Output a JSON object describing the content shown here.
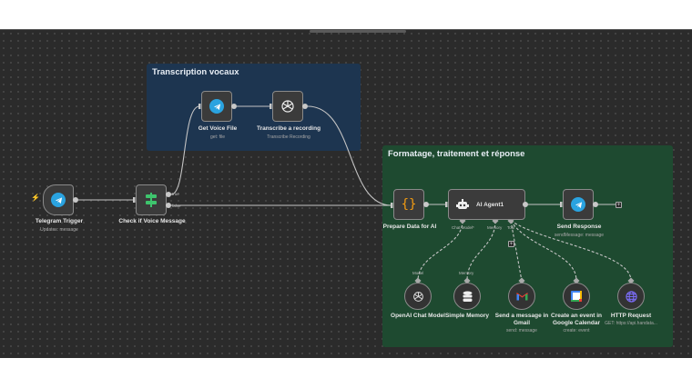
{
  "groups": [
    {
      "title": "Transcription vocaux",
      "color": "#1d3550"
    },
    {
      "title": "Formatage, traitement et réponse",
      "color": "#1e4a30"
    }
  ],
  "nodes": {
    "telegram_trigger": {
      "label": "Telegram Trigger",
      "sub": "Updates: message",
      "icon": "telegram-icon"
    },
    "check_voice": {
      "label": "Check if Voice Message",
      "true_label": "true",
      "false_label": "false",
      "icon": "switch-icon"
    },
    "get_voice": {
      "label": "Get Voice File",
      "sub": "get: file",
      "icon": "telegram-icon"
    },
    "transcribe": {
      "label": "Transcribe a recording",
      "sub": "Transcribe Recording",
      "icon": "openai-icon"
    },
    "prepare": {
      "label": "Prepare Data for AI",
      "icon": "code-braces-icon"
    },
    "agent": {
      "label": "AI Agent1",
      "ports": [
        "Chat Model*",
        "Memory",
        "Tool"
      ],
      "icon": "robot-icon"
    },
    "send": {
      "label": "Send Response",
      "sub": "sendMessage: message",
      "icon": "telegram-icon"
    },
    "openai_model": {
      "label": "OpenAI Chat Model",
      "port": "Model",
      "icon": "openai-icon"
    },
    "memory": {
      "label": "Simple Memory",
      "port": "Memory",
      "icon": "database-icon"
    },
    "gmail": {
      "label": "Send a message in Gmail",
      "sub": "send: message",
      "icon": "gmail-icon"
    },
    "calendar": {
      "label": "Create an event in Google Calendar",
      "sub": "create: event",
      "icon": "google-calendar-icon"
    },
    "http": {
      "label": "HTTP Request",
      "sub": "GET: https://api.handata...",
      "icon": "globe-icon"
    }
  },
  "colors": {
    "telegram": "#2aa3e0",
    "switch": "#3ec46d",
    "code": "#f39c12",
    "http": "#7b6cf6"
  }
}
